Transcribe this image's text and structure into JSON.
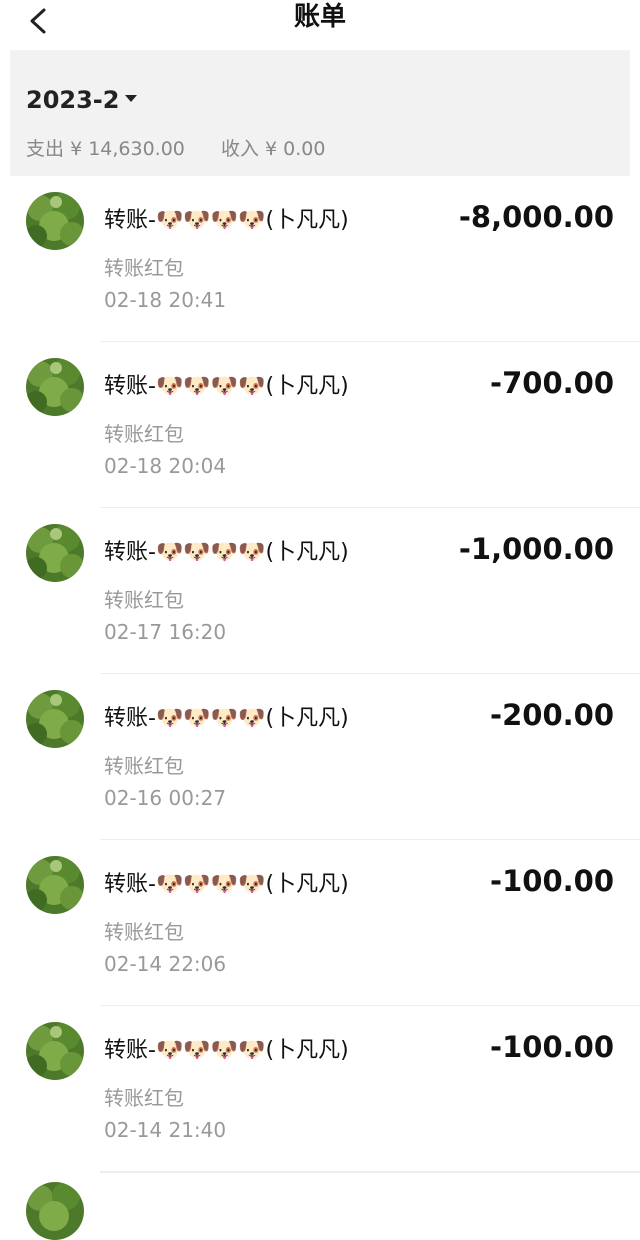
{
  "header": {
    "title": "账单",
    "back_icon": "chevron-left-icon"
  },
  "summary": {
    "month": "2023-2",
    "expense_label": "支出",
    "expense_value": "¥ 14,630.00",
    "income_label": "收入",
    "income_value": "¥ 0.00"
  },
  "transactions": [
    {
      "name": "转账-🐶🐶🐶🐶(卜凡凡)",
      "type": "转账红包",
      "time": "02-18  20:41",
      "amount": "-8,000.00"
    },
    {
      "name": "转账-🐶🐶🐶🐶(卜凡凡)",
      "type": "转账红包",
      "time": "02-18  20:04",
      "amount": "-700.00"
    },
    {
      "name": "转账-🐶🐶🐶🐶(卜凡凡)",
      "type": "转账红包",
      "time": "02-17  16:20",
      "amount": "-1,000.00"
    },
    {
      "name": "转账-🐶🐶🐶🐶(卜凡凡)",
      "type": "转账红包",
      "time": "02-16  00:27",
      "amount": "-200.00"
    },
    {
      "name": "转账-🐶🐶🐶🐶(卜凡凡)",
      "type": "转账红包",
      "time": "02-14  22:06",
      "amount": "-100.00"
    },
    {
      "name": "转账-🐶🐶🐶🐶(卜凡凡)",
      "type": "转账红包",
      "time": "02-14  21:40",
      "amount": "-100.00"
    }
  ]
}
